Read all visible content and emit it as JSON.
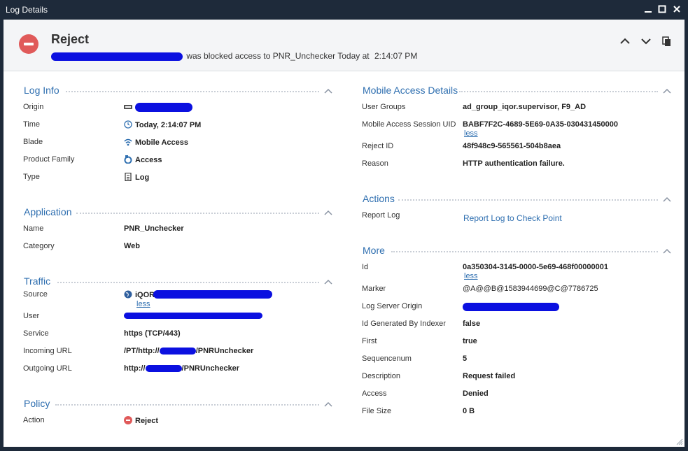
{
  "window": {
    "title": "Log Details"
  },
  "header": {
    "title": "Reject",
    "message_mid": "was blocked access to PNR_Unchecker Today at",
    "message_time": "2:14:07 PM"
  },
  "log_info": {
    "title": "Log Info",
    "origin_label": "Origin",
    "time_label": "Time",
    "time_value": "Today, 2:14:07 PM",
    "blade_label": "Blade",
    "blade_value": "Mobile Access",
    "product_family_label": "Product Family",
    "product_family_value": "Access",
    "type_label": "Type",
    "type_value": "Log"
  },
  "application": {
    "title": "Application",
    "name_label": "Name",
    "name_value": "PNR_Unchecker",
    "category_label": "Category",
    "category_value": "Web"
  },
  "traffic": {
    "title": "Traffic",
    "source_label": "Source",
    "source_value": "iQOR",
    "source_less": "less",
    "user_label": "User",
    "service_label": "Service",
    "service_value": "https (TCP/443)",
    "incoming_url_label": "Incoming URL",
    "incoming_url_prefix": "/PT/http://",
    "incoming_url_suffix": "/PNRUnchecker",
    "outgoing_url_label": "Outgoing URL",
    "outgoing_url_prefix": "http://",
    "outgoing_url_suffix": "/PNRUnchecker"
  },
  "policy": {
    "title": "Policy",
    "action_label": "Action",
    "action_value": "Reject"
  },
  "mobile_access": {
    "title": "Mobile Access Details",
    "user_groups_label": "User Groups",
    "user_groups_value": "ad_group_iqor.supervisor, F9_AD",
    "session_uid_label": "Mobile Access Session UID",
    "session_uid_value": "BABF7F2C-4689-5E69-0A35-030431450000",
    "session_uid_less": "less",
    "reject_id_label": "Reject ID",
    "reject_id_value": "48f948c9-565561-504b8aea",
    "reason_label": "Reason",
    "reason_value": "HTTP authentication failure."
  },
  "actions": {
    "title": "Actions",
    "report_log_label": "Report Log",
    "report_log_link": "Report Log to Check Point"
  },
  "more": {
    "title": "More",
    "id_label": "Id",
    "id_value": "0a350304-3145-0000-5e69-468f00000001",
    "id_less": "less",
    "marker_label": "Marker",
    "marker_value": "@A@@B@1583944699@C@7786725",
    "log_server_origin_label": "Log Server Origin",
    "id_gen_label": "Id Generated By Indexer",
    "id_gen_value": "false",
    "first_label": "First",
    "first_value": "true",
    "sequencenum_label": "Sequencenum",
    "sequencenum_value": "5",
    "description_label": "Description",
    "description_value": "Request failed",
    "access_label": "Access",
    "access_value": "Denied",
    "file_size_label": "File Size",
    "file_size_value": "0 B"
  },
  "colors": {
    "accent": "#2f6fb0",
    "reject": "#e05a5a",
    "redaction": "#0b10e0",
    "titlebar": "#1e2a3a"
  }
}
